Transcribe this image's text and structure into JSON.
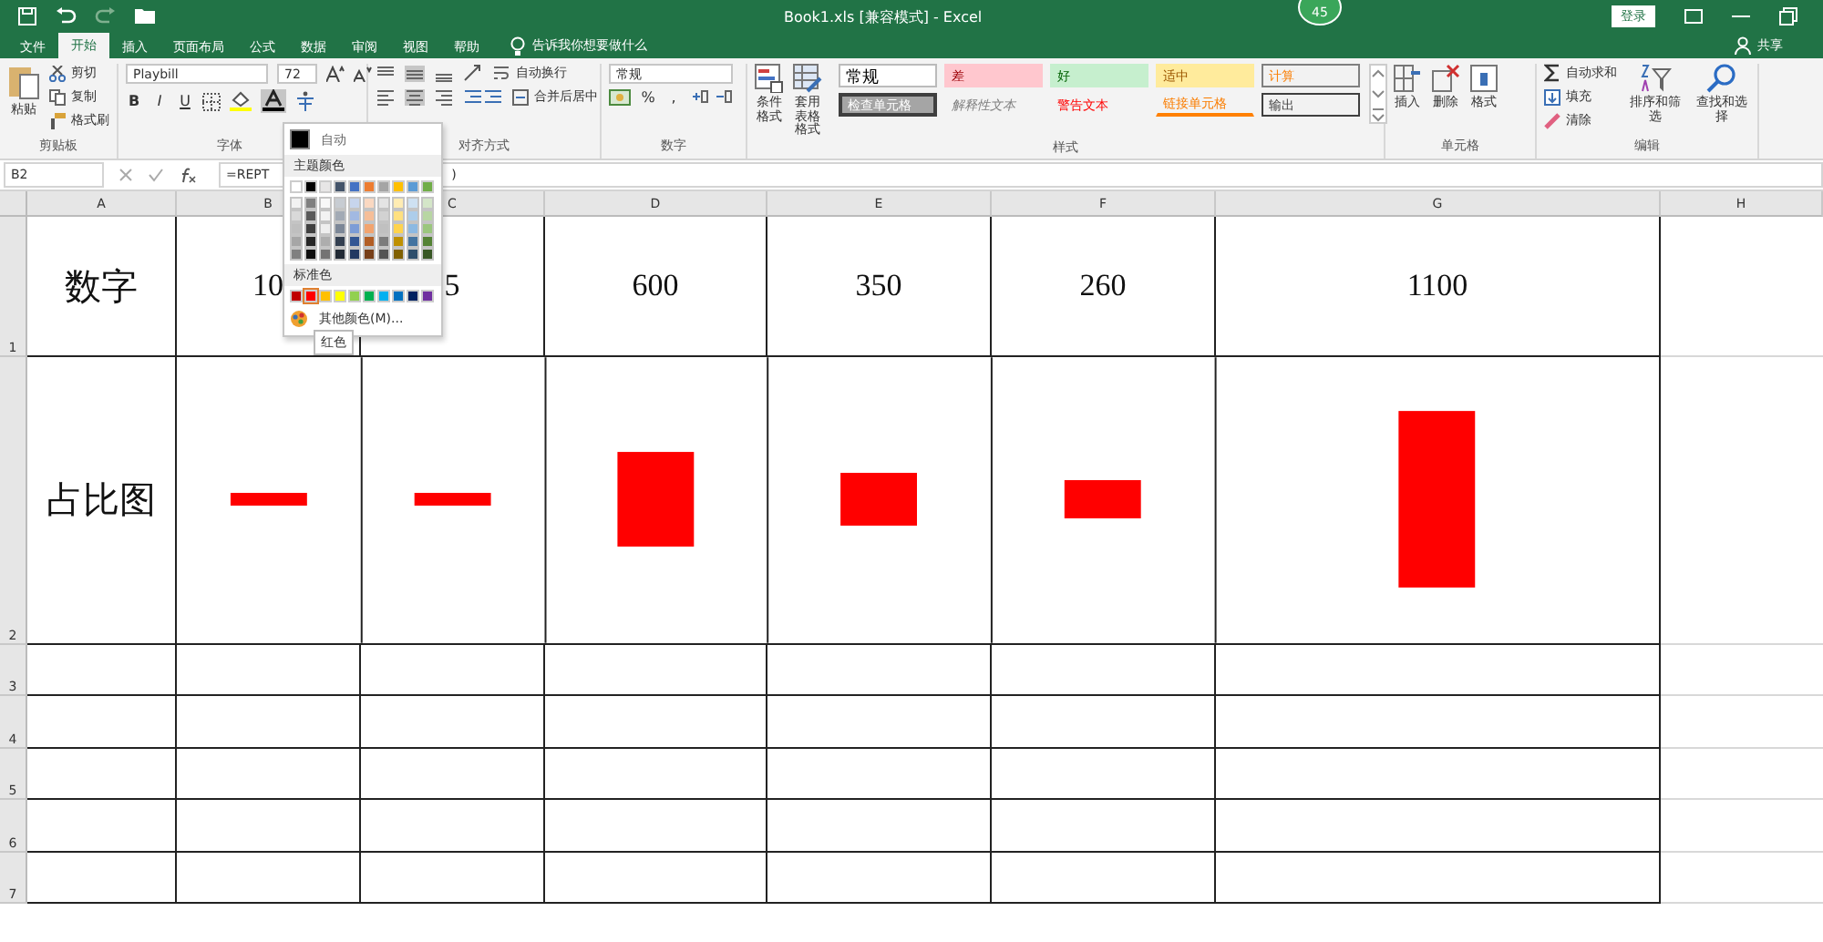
{
  "title_bar": {
    "title": "Book1.xls [兼容模式] - Excel",
    "badge": "45",
    "sign_in": "登录"
  },
  "tabs": [
    {
      "label": "文件",
      "selected": false
    },
    {
      "label": "开始",
      "selected": true
    },
    {
      "label": "插入",
      "selected": false
    },
    {
      "label": "页面布局",
      "selected": false
    },
    {
      "label": "公式",
      "selected": false
    },
    {
      "label": "数据",
      "selected": false
    },
    {
      "label": "审阅",
      "selected": false
    },
    {
      "label": "视图",
      "selected": false
    },
    {
      "label": "帮助",
      "selected": false
    }
  ],
  "tell_me": "告诉我你想要做什么",
  "share": "共享",
  "clipboard": {
    "paste": "粘贴",
    "cut": "剪切",
    "copy": "复制",
    "format_painter": "格式刷",
    "label": "剪贴板"
  },
  "font": {
    "name": "Playbill",
    "size": "72",
    "bold": "B",
    "italic": "I",
    "underline": "U",
    "label": "字体"
  },
  "alignment": {
    "wrap": "自动换行",
    "merge": "合并后居中",
    "label": "对齐方式"
  },
  "number": {
    "format": "常规",
    "percent": "%",
    "comma": ",",
    "label": "数字"
  },
  "styles": {
    "conditional": "条件格式",
    "table_format": [
      "套用",
      "表格格式"
    ],
    "label": "样式",
    "cells": [
      {
        "label": "常规",
        "kind": "normal"
      },
      {
        "label": "差",
        "kind": "bad"
      },
      {
        "label": "好",
        "kind": "good"
      },
      {
        "label": "适中",
        "kind": "neutral"
      },
      {
        "label": "计算",
        "kind": "calc"
      },
      {
        "label": "检查单元格",
        "kind": "check"
      },
      {
        "label": "解释性文本",
        "kind": "explanatory"
      },
      {
        "label": "警告文本",
        "kind": "warning"
      },
      {
        "label": "链接单元格",
        "kind": "linked"
      },
      {
        "label": "输出",
        "kind": "output"
      }
    ]
  },
  "cells_group": {
    "insert": "插入",
    "delete": "删除",
    "format": "格式",
    "label": "单元格"
  },
  "editing": {
    "autosum": "自动求和",
    "fill": "填充",
    "clear": "清除",
    "sort": "排序和筛选",
    "find": "查找和选择",
    "label": "编辑"
  },
  "formula_bar": {
    "name_box": "B2",
    "formula": "=REPT",
    "formula_tail": ")"
  },
  "columns": [
    "A",
    "B",
    "C",
    "D",
    "E",
    "F",
    "G",
    "H"
  ],
  "rows": [
    {
      "number": "1",
      "cells": [
        "数字",
        "10",
        "5",
        "600",
        "350",
        "260",
        "1100",
        ""
      ]
    },
    {
      "number": "2",
      "label": "占比图",
      "kind": "bar_picture"
    },
    {
      "number": "3"
    },
    {
      "number": "4"
    },
    {
      "number": "5"
    },
    {
      "number": "6"
    },
    {
      "number": "7"
    }
  ],
  "color_menu": {
    "auto": "自动",
    "theme_header": "主题颜色",
    "standard_header": "标准色",
    "more": "其他颜色(M)...",
    "tooltip": "红色",
    "theme_colors": [
      {
        "color": "#ffffff"
      },
      {
        "color": "#000000"
      },
      {
        "color": "#e7e6e6"
      },
      {
        "color": "#44546a"
      },
      {
        "color": "#4472c4"
      },
      {
        "color": "#ed7d31"
      },
      {
        "color": "#a5a5a5"
      },
      {
        "color": "#ffc000"
      },
      {
        "color": "#5b9bd5"
      },
      {
        "color": "#70ad47"
      }
    ],
    "standard_colors": [
      {
        "color": "#c00000",
        "selected": false
      },
      {
        "color": "#ff0000",
        "selected": true
      },
      {
        "color": "#ffc000",
        "selected": false
      },
      {
        "color": "#ffff00",
        "selected": false
      },
      {
        "color": "#92d050",
        "selected": false
      },
      {
        "color": "#00b050",
        "selected": false
      },
      {
        "color": "#00b0f0",
        "selected": false
      },
      {
        "color": "#0070c0",
        "selected": false
      },
      {
        "color": "#002060",
        "selected": false
      },
      {
        "color": "#7030a0",
        "selected": false
      }
    ]
  }
}
